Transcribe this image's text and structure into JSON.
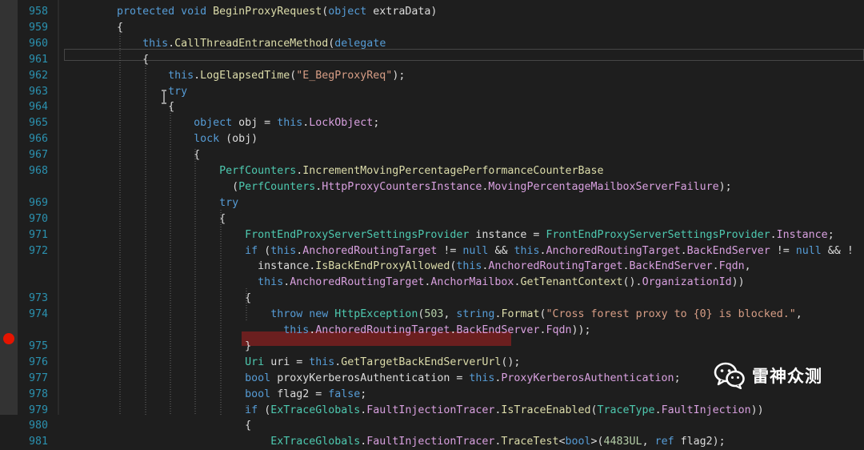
{
  "editor": {
    "lines": [
      {
        "n": "958",
        "tokens": [
          {
            "t": "        "
          },
          {
            "t": "protected void ",
            "c": "kw"
          },
          {
            "t": "BeginProxyRequest",
            "c": "mt"
          },
          {
            "t": "("
          },
          {
            "t": "object ",
            "c": "kw"
          },
          {
            "t": "extraData)"
          }
        ]
      },
      {
        "n": "959",
        "tokens": [
          {
            "t": "        {"
          }
        ]
      },
      {
        "n": "960",
        "tokens": [
          {
            "t": "            "
          },
          {
            "t": "this",
            "c": "kw"
          },
          {
            "t": "."
          },
          {
            "t": "CallThreadEntranceMethod",
            "c": "mt"
          },
          {
            "t": "("
          },
          {
            "t": "delegate",
            "c": "kw"
          }
        ]
      },
      {
        "n": "961",
        "tokens": [
          {
            "t": "            {"
          }
        ]
      },
      {
        "n": "962",
        "tokens": [
          {
            "t": "                "
          },
          {
            "t": "this",
            "c": "kw"
          },
          {
            "t": "."
          },
          {
            "t": "LogElapsedTime",
            "c": "mt"
          },
          {
            "t": "("
          },
          {
            "t": "\"E_BegProxyReq\"",
            "c": "st"
          },
          {
            "t": ");"
          }
        ]
      },
      {
        "n": "963",
        "tokens": [
          {
            "t": "                "
          },
          {
            "t": "try",
            "c": "kw"
          }
        ]
      },
      {
        "n": "964",
        "tokens": [
          {
            "t": "                {"
          }
        ]
      },
      {
        "n": "965",
        "tokens": [
          {
            "t": "                    "
          },
          {
            "t": "object ",
            "c": "kw"
          },
          {
            "t": "obj = "
          },
          {
            "t": "this",
            "c": "kw"
          },
          {
            "t": "."
          },
          {
            "t": "LockObject",
            "c": "pr"
          },
          {
            "t": ";"
          }
        ]
      },
      {
        "n": "966",
        "tokens": [
          {
            "t": "                    "
          },
          {
            "t": "lock ",
            "c": "kw"
          },
          {
            "t": "(obj)"
          }
        ]
      },
      {
        "n": "967",
        "tokens": [
          {
            "t": "                    {"
          }
        ]
      },
      {
        "n": "968",
        "tokens": [
          {
            "t": "                        "
          },
          {
            "t": "PerfCounters",
            "c": "ty"
          },
          {
            "t": "."
          },
          {
            "t": "IncrementMovingPercentagePerformanceCounterBase",
            "c": "mt"
          }
        ]
      },
      {
        "n": "",
        "tokens": [
          {
            "t": "                          ("
          },
          {
            "t": "PerfCounters",
            "c": "ty"
          },
          {
            "t": "."
          },
          {
            "t": "HttpProxyCountersInstance",
            "c": "pr"
          },
          {
            "t": "."
          },
          {
            "t": "MovingPercentageMailboxServerFailure",
            "c": "pr"
          },
          {
            "t": ");"
          }
        ]
      },
      {
        "n": "969",
        "tokens": [
          {
            "t": "                        "
          },
          {
            "t": "try",
            "c": "kw"
          }
        ]
      },
      {
        "n": "970",
        "tokens": [
          {
            "t": "                        {"
          }
        ]
      },
      {
        "n": "971",
        "tokens": [
          {
            "t": "                            "
          },
          {
            "t": "FrontEndProxyServerSettingsProvider ",
            "c": "ty"
          },
          {
            "t": "instance = "
          },
          {
            "t": "FrontEndProxyServerSettingsProvider",
            "c": "ty"
          },
          {
            "t": "."
          },
          {
            "t": "Instance",
            "c": "pr"
          },
          {
            "t": ";"
          }
        ]
      },
      {
        "n": "972",
        "tokens": [
          {
            "t": "                            "
          },
          {
            "t": "if ",
            "c": "kw"
          },
          {
            "t": "("
          },
          {
            "t": "this",
            "c": "kw"
          },
          {
            "t": "."
          },
          {
            "t": "AnchoredRoutingTarget",
            "c": "pr"
          },
          {
            "t": " != "
          },
          {
            "t": "null",
            "c": "kw"
          },
          {
            "t": " && "
          },
          {
            "t": "this",
            "c": "kw"
          },
          {
            "t": "."
          },
          {
            "t": "AnchoredRoutingTarget",
            "c": "pr"
          },
          {
            "t": "."
          },
          {
            "t": "BackEndServer",
            "c": "pr"
          },
          {
            "t": " != "
          },
          {
            "t": "null",
            "c": "kw"
          },
          {
            "t": " && !"
          }
        ]
      },
      {
        "n": "",
        "tokens": [
          {
            "t": "                              instance."
          },
          {
            "t": "IsBackEndProxyAllowed",
            "c": "mt"
          },
          {
            "t": "("
          },
          {
            "t": "this",
            "c": "kw"
          },
          {
            "t": "."
          },
          {
            "t": "AnchoredRoutingTarget",
            "c": "pr"
          },
          {
            "t": "."
          },
          {
            "t": "BackEndServer",
            "c": "pr"
          },
          {
            "t": "."
          },
          {
            "t": "Fqdn",
            "c": "pr"
          },
          {
            "t": ","
          }
        ]
      },
      {
        "n": "",
        "tokens": [
          {
            "t": "                              "
          },
          {
            "t": "this",
            "c": "kw"
          },
          {
            "t": "."
          },
          {
            "t": "AnchoredRoutingTarget",
            "c": "pr"
          },
          {
            "t": "."
          },
          {
            "t": "AnchorMailbox",
            "c": "pr"
          },
          {
            "t": "."
          },
          {
            "t": "GetTenantContext",
            "c": "mt"
          },
          {
            "t": "()."
          },
          {
            "t": "OrganizationId",
            "c": "pr"
          },
          {
            "t": "))"
          }
        ]
      },
      {
        "n": "973",
        "tokens": [
          {
            "t": "                            {"
          }
        ]
      },
      {
        "n": "974",
        "tokens": [
          {
            "t": "                                "
          },
          {
            "t": "throw new ",
            "c": "kw"
          },
          {
            "t": "HttpException",
            "c": "ty"
          },
          {
            "t": "("
          },
          {
            "t": "503",
            "c": "nm"
          },
          {
            "t": ", "
          },
          {
            "t": "string",
            "c": "kw"
          },
          {
            "t": "."
          },
          {
            "t": "Format",
            "c": "mt"
          },
          {
            "t": "("
          },
          {
            "t": "\"Cross forest proxy to {0} is blocked.\"",
            "c": "st"
          },
          {
            "t": ","
          }
        ]
      },
      {
        "n": "",
        "tokens": [
          {
            "t": "                                  "
          },
          {
            "t": "this",
            "c": "kw"
          },
          {
            "t": "."
          },
          {
            "t": "AnchoredRoutingTarget",
            "c": "pr"
          },
          {
            "t": "."
          },
          {
            "t": "BackEndServer",
            "c": "pr"
          },
          {
            "t": "."
          },
          {
            "t": "Fqdn",
            "c": "pr"
          },
          {
            "t": "));"
          }
        ]
      },
      {
        "n": "975",
        "tokens": [
          {
            "t": "                            }"
          }
        ]
      },
      {
        "n": "976",
        "tokens": [
          {
            "t": "                            "
          },
          {
            "t": "Uri ",
            "c": "ty"
          },
          {
            "t": "uri = "
          },
          {
            "t": "this",
            "c": "kw"
          },
          {
            "t": "."
          },
          {
            "t": "GetTargetBackEndServerUrl",
            "c": "mt"
          },
          {
            "t": "();"
          }
        ]
      },
      {
        "n": "977",
        "tokens": [
          {
            "t": "                            "
          },
          {
            "t": "bool ",
            "c": "kw"
          },
          {
            "t": "proxyKerberosAuthentication = "
          },
          {
            "t": "this",
            "c": "kw"
          },
          {
            "t": "."
          },
          {
            "t": "ProxyKerberosAuthentication",
            "c": "pr"
          },
          {
            "t": ";"
          }
        ]
      },
      {
        "n": "978",
        "tokens": [
          {
            "t": "                            "
          },
          {
            "t": "bool ",
            "c": "kw"
          },
          {
            "t": "flag2 = "
          },
          {
            "t": "false",
            "c": "kw"
          },
          {
            "t": ";"
          }
        ]
      },
      {
        "n": "979",
        "tokens": [
          {
            "t": "                            "
          },
          {
            "t": "if ",
            "c": "kw"
          },
          {
            "t": "("
          },
          {
            "t": "ExTraceGlobals",
            "c": "ty"
          },
          {
            "t": "."
          },
          {
            "t": "FaultInjectionTracer",
            "c": "pr"
          },
          {
            "t": "."
          },
          {
            "t": "IsTraceEnabled",
            "c": "mt"
          },
          {
            "t": "("
          },
          {
            "t": "TraceType",
            "c": "ty"
          },
          {
            "t": "."
          },
          {
            "t": "FaultInjection",
            "c": "pr"
          },
          {
            "t": "))"
          }
        ]
      },
      {
        "n": "980",
        "tokens": [
          {
            "t": "                            {"
          }
        ]
      },
      {
        "n": "981",
        "tokens": [
          {
            "t": "                                "
          },
          {
            "t": "ExTraceGlobals",
            "c": "ty"
          },
          {
            "t": "."
          },
          {
            "t": "FaultInjectionTracer",
            "c": "pr"
          },
          {
            "t": "."
          },
          {
            "t": "TraceTest",
            "c": "mt"
          },
          {
            "t": "<"
          },
          {
            "t": "bool",
            "c": "kw"
          },
          {
            "t": ">("
          },
          {
            "t": "4483UL",
            "c": "nm"
          },
          {
            "t": ", "
          },
          {
            "t": "ref ",
            "c": "kw"
          },
          {
            "t": "flag2);"
          }
        ]
      }
    ],
    "breakpoint_line": "976",
    "current_line": "961"
  },
  "watermark": {
    "text": "雷神众测",
    "icon": "wechat-icon"
  },
  "colors": {
    "background": "#1e1e1e",
    "line_number": "#2b91af",
    "keyword": "#569cd6",
    "method": "#dcdcaa",
    "type": "#4ec9b0",
    "property": "#d8a0df",
    "string": "#d69d85",
    "breakpoint": "#e51400",
    "breakpoint_highlight": "#6b1f1f"
  }
}
